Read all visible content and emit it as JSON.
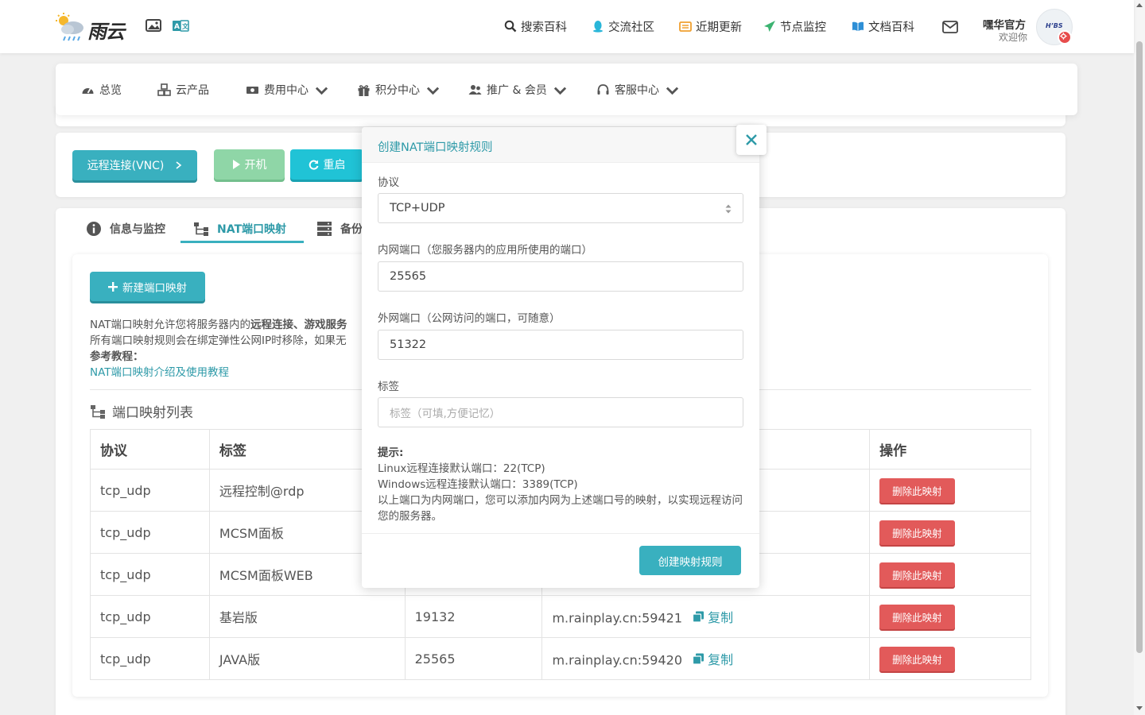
{
  "header": {
    "logo_text": "雨云",
    "nav": [
      {
        "label": "搜索百科",
        "icon": "search-icon"
      },
      {
        "label": "交流社区",
        "icon": "qq-icon"
      },
      {
        "label": "近期更新",
        "icon": "news-icon"
      },
      {
        "label": "节点监控",
        "icon": "send-icon"
      },
      {
        "label": "文档百科",
        "icon": "book-icon"
      }
    ],
    "mail_icon": "mail-icon",
    "user_name": "嘿华官方",
    "user_welcome": "欢迎你",
    "avatar_text": "H’BS"
  },
  "menu": [
    {
      "label": "总览",
      "icon": "dashboard-icon"
    },
    {
      "label": "云产品",
      "icon": "cubes-icon"
    },
    {
      "label": "费用中心",
      "icon": "money-icon"
    },
    {
      "label": "积分中心",
      "icon": "gift-icon"
    },
    {
      "label": "推广 & 会员",
      "icon": "users-icon"
    },
    {
      "label": "客服中心",
      "icon": "headset-icon"
    }
  ],
  "actions": {
    "vnc": "远程连接(VNC)",
    "start": "开机",
    "restart": "重启"
  },
  "tabs": [
    {
      "label": "信息与监控",
      "icon": "info-icon"
    },
    {
      "label": "NAT端口映射",
      "icon": "sitemap-icon"
    },
    {
      "label": "备份",
      "icon": "server-icon"
    }
  ],
  "nat": {
    "new_button": "新建端口映射",
    "desc_line1_a": "NAT端口映射允许您将服务器内的",
    "desc_line1_b": "远程连接、游戏服务",
    "desc_line2": "所有端口映射规则会在绑定弹性公网IP时移除，如果无",
    "ref_label": "参考教程：",
    "ref_link": "NAT端口映射介绍及使用教程",
    "list_title": "端口映射列表"
  },
  "table": {
    "headers": [
      "协议",
      "标签",
      "",
      "",
      "操作"
    ],
    "copy_label": "复制",
    "delete_label": "删除此映射",
    "rows": [
      {
        "protocol": "tcp_udp",
        "tag": "远程控制@rdp",
        "inner": "",
        "outer": ""
      },
      {
        "protocol": "tcp_udp",
        "tag": "MCSM面板",
        "inner": "",
        "outer": ""
      },
      {
        "protocol": "tcp_udp",
        "tag": "MCSM面板WEB",
        "inner": "",
        "outer": ""
      },
      {
        "protocol": "tcp_udp",
        "tag": "基岩版",
        "inner": "19132",
        "outer": "m.rainplay.cn:59421"
      },
      {
        "protocol": "tcp_udp",
        "tag": "JAVA版",
        "inner": "25565",
        "outer": "m.rainplay.cn:59420"
      }
    ]
  },
  "modal": {
    "title": "创建NAT端口映射规则",
    "protocol_label": "协议",
    "protocol_value": "TCP+UDP",
    "inner_label": "内网端口（您服务器内的应用所使用的端口）",
    "inner_value": "25565",
    "outer_label": "外网端口（公网访问的端口，可随意）",
    "outer_value": "51322",
    "tag_label": "标签",
    "tag_placeholder": "标签（可填,方便记忆）",
    "tip_title": "提示:",
    "tip_line1": "Linux远程连接默认端口：22(TCP)",
    "tip_line2": "Windows远程连接默认端口：3389(TCP)",
    "tip_line3": "以上端口为内网端口，您可以添加内网为上述端口号的映射，以实现远程访问您的服务器。",
    "submit": "创建映射规则"
  },
  "colors": {
    "accent": "#39b0bf",
    "danger": "#e25a5a",
    "start": "#8fd6a7",
    "restart": "#20c3d6"
  }
}
